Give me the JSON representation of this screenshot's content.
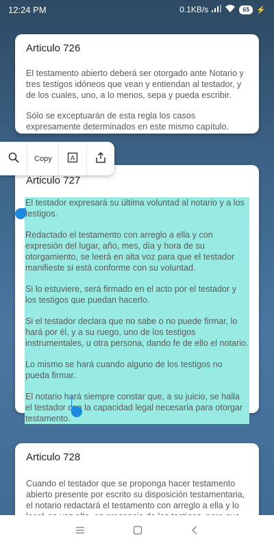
{
  "status_bar": {
    "time": "12:24 PM",
    "network_speed": "0.1KB/s",
    "battery": "65"
  },
  "toolbar": {
    "copy_label": "Copy"
  },
  "articles": [
    {
      "title": "Articulo 726",
      "paragraphs": [
        "El testamento abierto deberá ser otorgado ante Notario y tres testigos idóneos que vean y entiendan al testador, y de los cuales, uno, a lo menos, sepa y pueda escribir.",
        "Sólo se exceptuarán de esta regla los casos expresamente determinados en este mismo capítulo."
      ]
    },
    {
      "title": "Articulo 727",
      "paragraphs": [
        "El testador expresará su última voluntad al notario y a los testigos.",
        "Redactado el testamento con arreglo a ella y con expresión del lugar, año, mes, día y hora de su otorgamiento, se leerá en alta voz para que el testador manifieste si está conforme con su voluntad.",
        "Si lo estuviere, será firmado en el acto por el testador y los testigos que puedan hacerlo.",
        "Si el testador declara que no sabe o no puede firmar, lo hará por él, y a su ruego, uno de los testigos instrumentales, u otra persona, dando fe de ello el notario.",
        "Lo mismo se hará cuando alguno de los testigos no pueda firmar.",
        "El notario hará siempre constar que, a su juicio, se halla el testador con la capacidad legal necesaria para otorgar testamento."
      ]
    },
    {
      "title": "Articulo 728",
      "paragraphs": [
        "Cuando el testador que se proponga hacer testamento abierto presente por escrito su disposición testamentaria, el notario redactará el testamento con arreglo a ella y lo leerá en voz alta, en presencia de los testigos, para que"
      ]
    }
  ]
}
